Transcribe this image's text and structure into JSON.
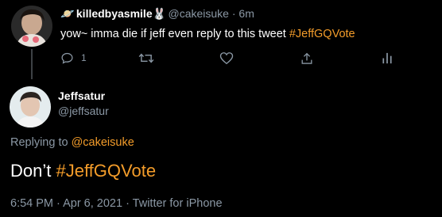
{
  "parent_tweet": {
    "avatar_icon": "user-avatar-icon",
    "name_emoji": "🪐",
    "display_name": "killedbyasmile",
    "name_emoji_suffix": "🐰",
    "handle": "@cakeisuke",
    "separator": " · ",
    "time_ago": "6m",
    "text_before": "yow~ imma die if jeff even reply to this tweet ",
    "hashtag": "#JeffGQVote",
    "actions": {
      "reply_icon": "reply-icon",
      "reply_count": "1",
      "retweet_icon": "retweet-icon",
      "like_icon": "heart-icon",
      "share_icon": "share-icon",
      "analytics_icon": "analytics-icon"
    }
  },
  "main_tweet": {
    "avatar_icon": "user-avatar-icon",
    "display_name": "Jeffsatur",
    "handle": "@jeffsatur",
    "replying_to_prefix": "Replying to ",
    "replying_to_handle": "@cakeisuke",
    "text_before": "Don’t ",
    "hashtag": "#JeffGQVote",
    "timestamp": "6:54 PM · Apr 6, 2021 · Twitter for iPhone"
  },
  "colors": {
    "background": "#000000",
    "accent": "#f39c2a",
    "secondary_text": "#8b98a5",
    "primary_text": "#ffffff"
  }
}
